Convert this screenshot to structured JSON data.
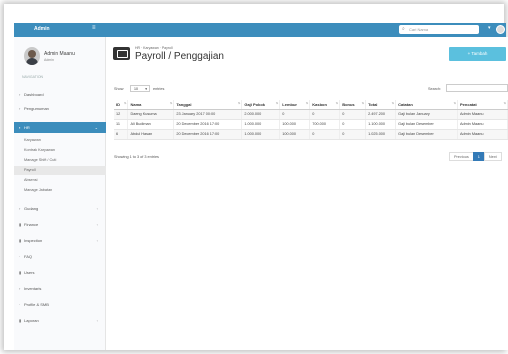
{
  "topbar": {
    "brand": "Admin",
    "toggle_icon": "bars-icon",
    "search_placeholder": "Cari Nama"
  },
  "user": {
    "name": "Admin Maanu",
    "role": "Admin"
  },
  "nav": {
    "header": "NAVIGATION",
    "items": [
      {
        "label": "Dashboard",
        "icon": "dashboard-icon"
      },
      {
        "label": "Pengumuman",
        "icon": "bullhorn-icon"
      },
      {
        "label": "HR",
        "icon": "users-icon",
        "active": true
      },
      {
        "label": "Gudang",
        "icon": "cube-icon"
      },
      {
        "label": "Finance",
        "icon": "money-icon"
      },
      {
        "label": "Inspection",
        "icon": "check-icon"
      },
      {
        "label": "FAQ",
        "icon": "question-icon"
      },
      {
        "label": "Users",
        "icon": "user-icon"
      },
      {
        "label": "Inventaris",
        "icon": "archive-icon"
      },
      {
        "label": "Profile & SMB",
        "icon": "building-icon"
      },
      {
        "label": "Laporan",
        "icon": "report-icon"
      }
    ],
    "hr_sub": [
      "Karyawan",
      "Kontrak Karyawan",
      "Manage Shift / Cuti",
      "Payroll",
      "Absensi",
      "Manage Jabatan"
    ]
  },
  "page": {
    "breadcrumb": "HR · Karyawan · Payroll",
    "title": "Payroll / Penggajian",
    "add_label": "+ Tambah"
  },
  "table_controls": {
    "show": "Show",
    "select_value": "10",
    "entries": "entries",
    "search": "Search:"
  },
  "table": {
    "headers": [
      "ID",
      "Nama",
      "Tanggal",
      "Gaji Pokok",
      "Lembur",
      "Kasbon",
      "Bonus",
      "Total",
      "Catatan",
      "Pencatat"
    ],
    "rows": [
      [
        "12",
        "Daeng Kusuma",
        "23 January 2017 00:00",
        "2.000.000",
        "0",
        "0",
        "0",
        "2.497.200",
        "Gaji bulan January",
        "Admin Maanu"
      ],
      [
        "11",
        "Ali Budiman",
        "20 December 2016 17:00",
        "1.000.000",
        "100.000",
        "700.000",
        "0",
        "1.100.000",
        "Gaji bulan Desember",
        "Admin Maanu"
      ],
      [
        "6",
        "Abdul Hasan",
        "20 December 2016 17:00",
        "1.000.000",
        "100.000",
        "0",
        "0",
        "1.025.000",
        "Gaji bulan Desember",
        "Admin Maanu"
      ]
    ]
  },
  "footer": {
    "info": "Showing 1 to 3 of 3 entries",
    "prev": "Previous",
    "page": "1",
    "next": "Next"
  }
}
